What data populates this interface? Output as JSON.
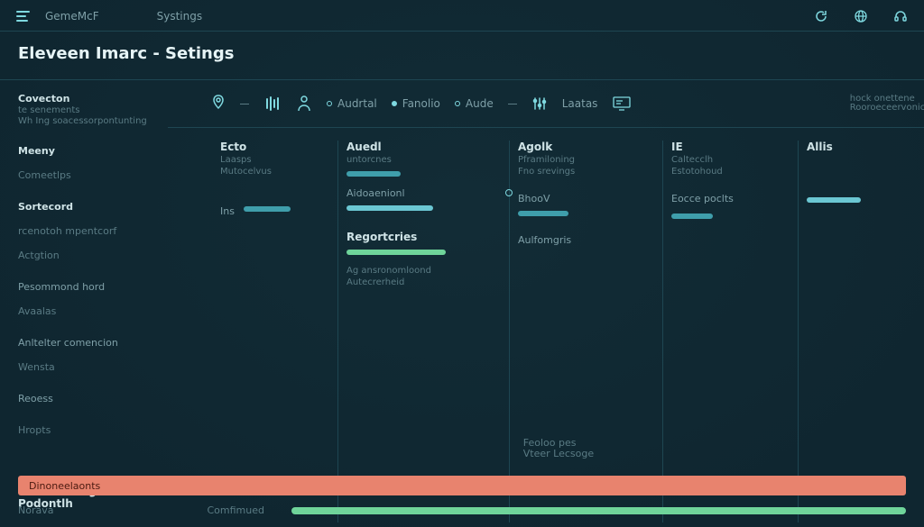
{
  "topbar": {
    "brand": "GemeMcF",
    "center": "Systings"
  },
  "title": "Eleveen Imarc - Setings",
  "sidebar": {
    "group1": {
      "head": "Covecton",
      "sub1": "te senements",
      "sub2": "Wh Ing soacessorpontunting"
    },
    "items": [
      {
        "label": "Meeny",
        "strong": true
      },
      {
        "label": "Comeetlps"
      },
      {
        "label": "Sortecord",
        "strong": true
      },
      {
        "label": "rcenotoh mpentcorf"
      },
      {
        "label": "Actgtion"
      },
      {
        "label": "Pesommond hord",
        "light": true
      },
      {
        "label": "Avaalas"
      },
      {
        "label": "Anltelter comencion",
        "light": true
      },
      {
        "label": "Wensta"
      },
      {
        "label": "Reoess",
        "light": true
      },
      {
        "label": "Hropts"
      }
    ],
    "footer": "Reoovoncdlgr Podontlh"
  },
  "tabs": [
    {
      "type": "icon",
      "name": "pin-icon"
    },
    {
      "type": "sep"
    },
    {
      "type": "icon",
      "name": "bars-icon"
    },
    {
      "type": "icon",
      "name": "person-icon"
    },
    {
      "type": "dot-label",
      "label": "Audrtal"
    },
    {
      "type": "dot-label",
      "label": "Fanolio",
      "fill": true
    },
    {
      "type": "dot-label",
      "label": "Aude"
    },
    {
      "type": "sep"
    },
    {
      "type": "icon",
      "name": "sliders-icon"
    },
    {
      "type": "label",
      "label": "Laatas"
    },
    {
      "type": "icon",
      "name": "monitor-icon"
    }
  ],
  "tabright": {
    "line1": "hock onettene",
    "line2": "Rooroeceervonicl"
  },
  "columns": {
    "c1": {
      "head": "Ecto",
      "sub1": "Laasps",
      "sub2": "Mutocelvus",
      "row1": "Ins"
    },
    "c2": {
      "head": "Auedl",
      "sub": "untorcnes",
      "row1": "Aidoaenionl",
      "head2": "Regortcries",
      "foot1": "Ag ansronomloond",
      "foot2": "Autecrerheid"
    },
    "c3": {
      "head": "Agolk",
      "sub1": "Pframiloning",
      "sub2": "Fno srevings",
      "row1": "BhooV",
      "row2": "Aulfomgris"
    },
    "c4": {
      "head": "IE",
      "sub1": "Caltecclh",
      "sub2": "Estotohoud",
      "row1": "Eocce poclts"
    },
    "c5": {
      "head": "Allis"
    }
  },
  "gridfoot": {
    "line1": "Feoloo pes",
    "line2": "Vteer Lecsoge"
  },
  "bottom": {
    "coral": "Dinoneelaonts",
    "left": "Norava",
    "mid": "Comfimued"
  }
}
